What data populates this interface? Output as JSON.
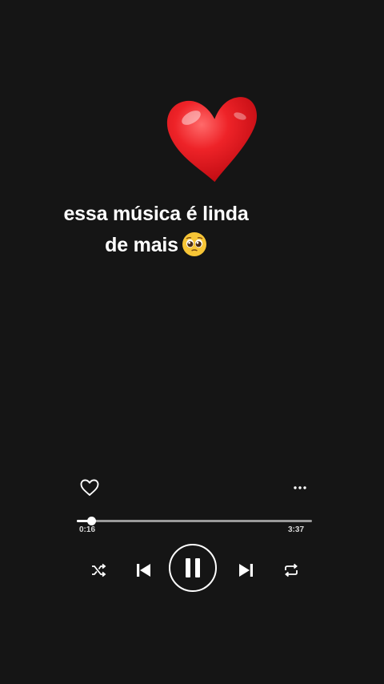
{
  "caption": {
    "line1": "essa música é linda",
    "line2": "de mais"
  },
  "player": {
    "elapsed": "0:16",
    "total": "3:37",
    "progress_fraction": 0.06,
    "state": "playing"
  },
  "icons": {
    "heart_emoji": "red-heart-emoji",
    "pleading_emoji": "pleading-face-emoji",
    "like": "heart-outline-icon",
    "more": "more-dots-icon",
    "shuffle": "shuffle-icon",
    "previous": "skip-previous-icon",
    "pause": "pause-icon",
    "next": "skip-next-icon",
    "repeat": "repeat-icon"
  },
  "colors": {
    "background": "#151515",
    "foreground": "#ffffff",
    "heart_red": "#e0141e"
  }
}
